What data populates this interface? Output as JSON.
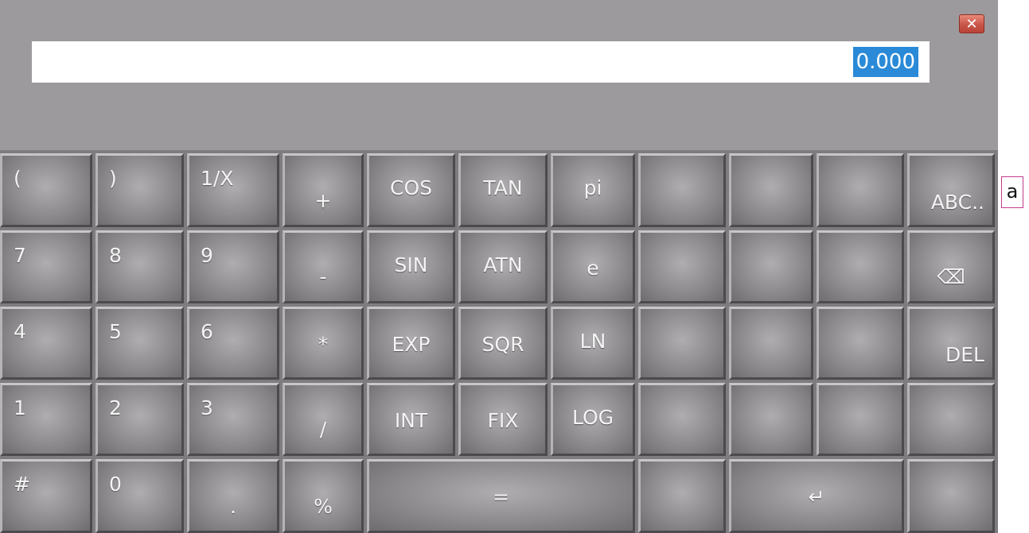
{
  "window": {
    "close_glyph": "✕"
  },
  "display": {
    "value": "0.000"
  },
  "keys": {
    "lparen": "(",
    "rparen": ")",
    "recip": "1/X",
    "plus": "+",
    "cos": "COS",
    "tan": "TAN",
    "pi": "pi",
    "abc": "ABC..",
    "n7": "7",
    "n8": "8",
    "n9": "9",
    "minus": "-",
    "sin": "SIN",
    "atn": "ATN",
    "e": "e",
    "backspace_glyph": "⌫",
    "n4": "4",
    "n5": "5",
    "n6": "6",
    "multiply": "*",
    "exp": "EXP",
    "sqr": "SQR",
    "ln": "LN",
    "del": "DEL",
    "n1": "1",
    "n2": "2",
    "n3": "3",
    "divide": "/",
    "int": "INT",
    "fix": "FIX",
    "log": "LOG",
    "hash": "#",
    "n0": "0",
    "dot": ".",
    "percent": "%",
    "equals": "=",
    "enter_glyph": "↵"
  },
  "side_tag": "a"
}
